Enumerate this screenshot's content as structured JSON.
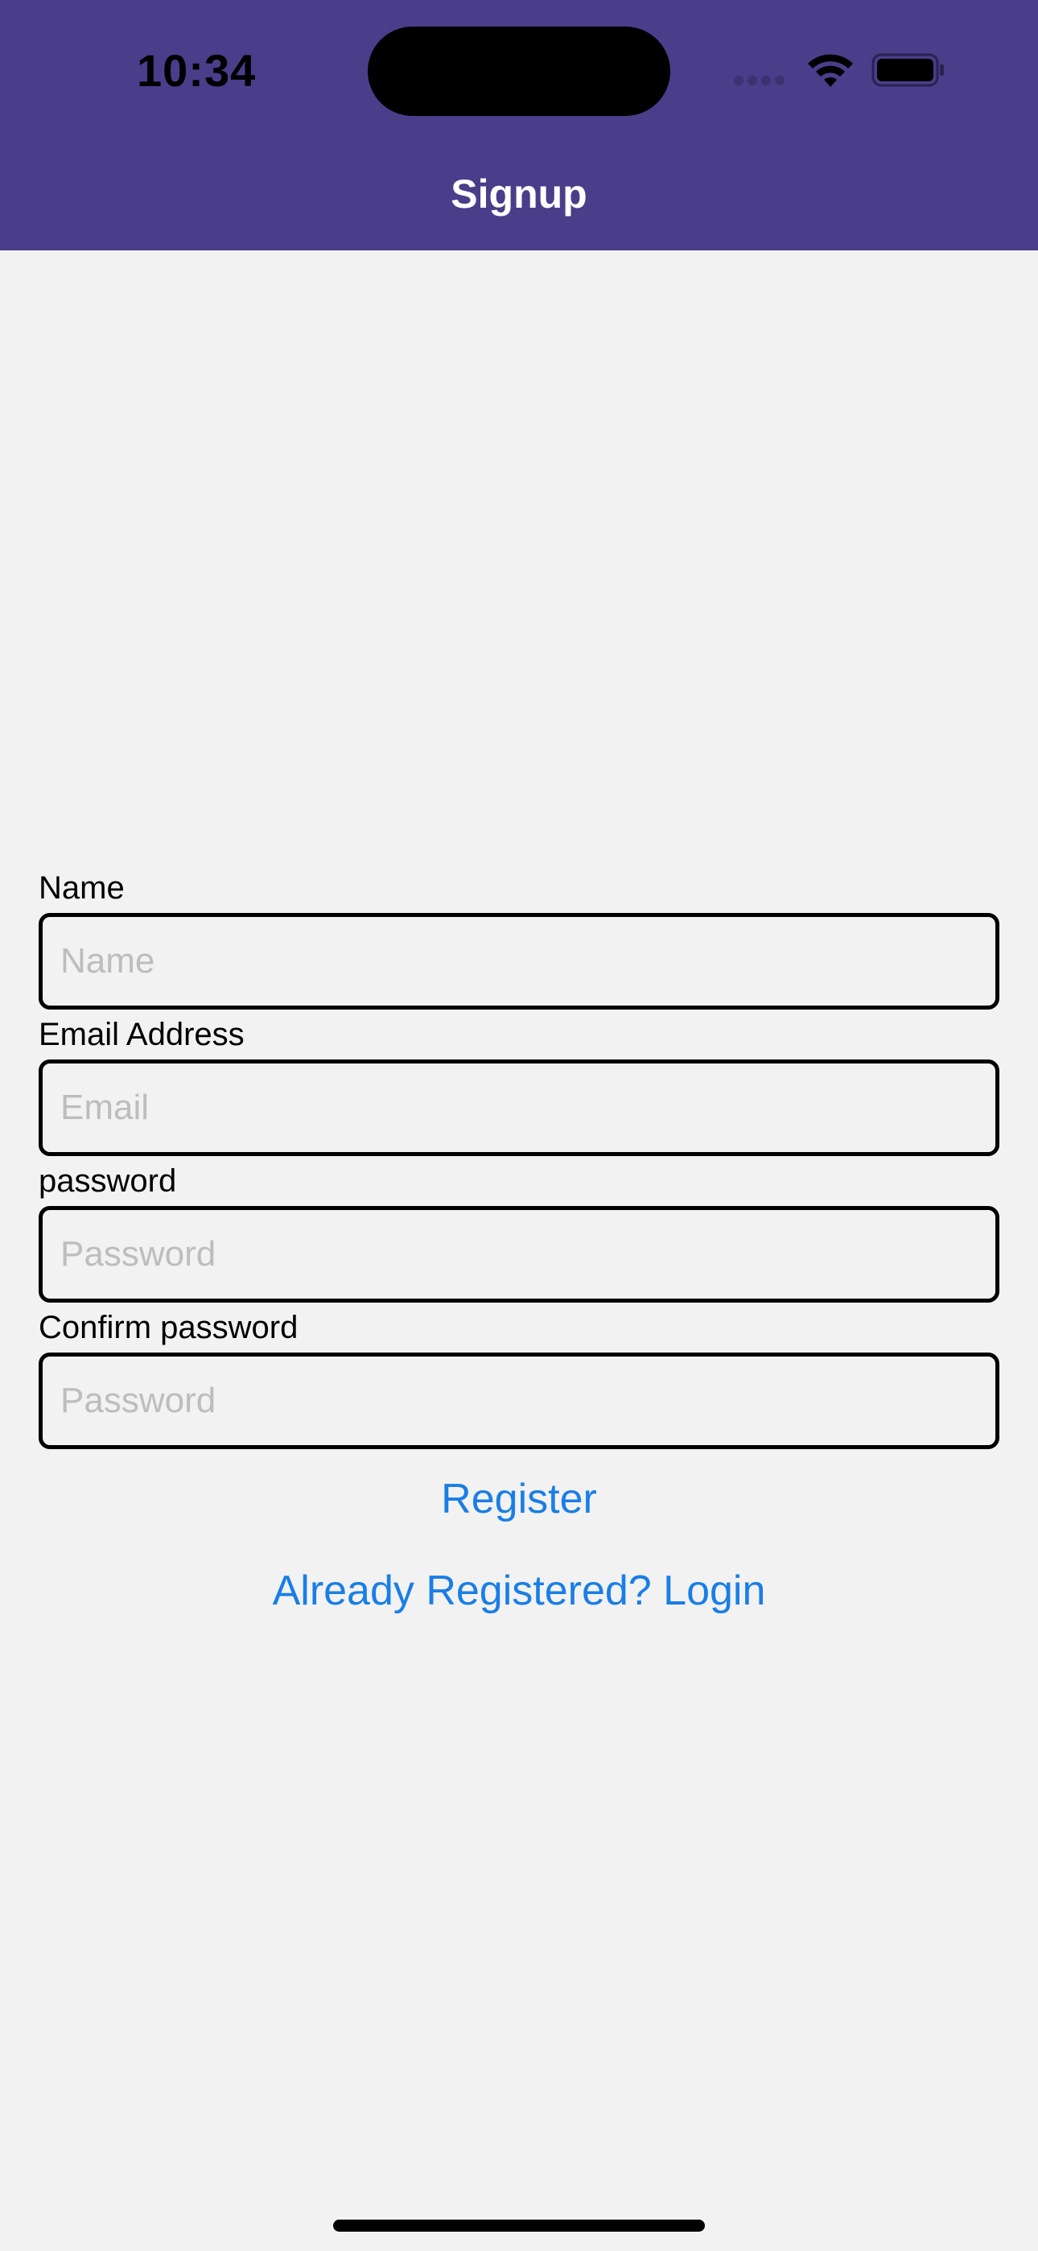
{
  "status_bar": {
    "time": "10:34"
  },
  "header": {
    "title": "Signup",
    "background_color": "#4a3d8a"
  },
  "form": {
    "fields": [
      {
        "label": "Name",
        "placeholder": "Name",
        "value": ""
      },
      {
        "label": "Email Address",
        "placeholder": "Email",
        "value": ""
      },
      {
        "label": "password",
        "placeholder": "Password",
        "value": ""
      },
      {
        "label": "Confirm password",
        "placeholder": "Password",
        "value": ""
      }
    ],
    "register_label": "Register",
    "login_link_label": "Already Registered? Login",
    "link_color": "#1a7ee6"
  },
  "icons": {
    "signal": "cellular-signal-icon",
    "wifi": "wifi-icon",
    "battery": "battery-icon"
  }
}
